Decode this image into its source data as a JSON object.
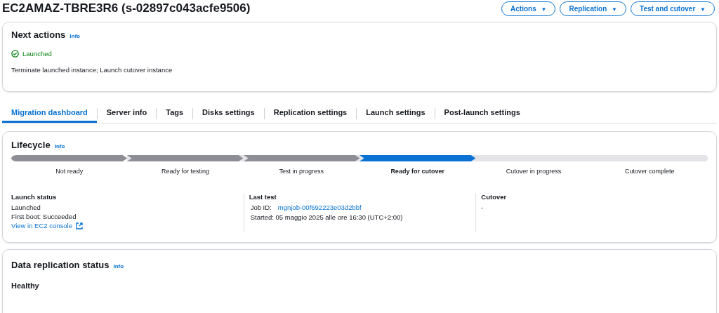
{
  "header": {
    "title": "EC2AMAZ-TBRE3R6 (s-02897c043acfe9506)",
    "buttons": [
      {
        "label": "Actions",
        "caret": "▼"
      },
      {
        "label": "Replication",
        "caret": "▼"
      },
      {
        "label": "Test and cutover",
        "caret": "▼"
      }
    ]
  },
  "next_actions": {
    "title": "Next actions",
    "info": "Info",
    "status": "Launched",
    "description": "Terminate launched instance; Launch cutover instance"
  },
  "tabs": [
    {
      "label": "Migration dashboard",
      "selected": true
    },
    {
      "label": "Server info",
      "selected": false
    },
    {
      "label": "Tags",
      "selected": false
    },
    {
      "label": "Disks settings",
      "selected": false
    },
    {
      "label": "Replication settings",
      "selected": false
    },
    {
      "label": "Launch settings",
      "selected": false
    },
    {
      "label": "Post-launch settings",
      "selected": false
    }
  ],
  "lifecycle": {
    "title": "Lifecycle",
    "info": "Info",
    "steps": [
      {
        "label": "Not ready",
        "done": true,
        "selected": false
      },
      {
        "label": "Ready for testing",
        "done": true,
        "selected": false
      },
      {
        "label": "Test in progress",
        "done": true,
        "selected": false
      },
      {
        "label": "Ready for cutover",
        "done": false,
        "selected": true
      },
      {
        "label": "Cutover in progress",
        "done": false,
        "selected": false
      },
      {
        "label": "Cutover complete",
        "done": false,
        "selected": false
      }
    ],
    "columns": [
      {
        "heading": "Launch status",
        "lines": [
          "Launched",
          "First boot: Succeeded"
        ],
        "link": "View in EC2 console"
      },
      {
        "heading": "Last test",
        "job_label": "Job ID:",
        "job_link": "mgnjob-00f692223e03d2bbf",
        "lines": [
          "Started: 05 maggio 2025 alle ore 16:30 (UTC+2:00)"
        ]
      },
      {
        "heading": "Cutover",
        "lines": [
          "-"
        ]
      }
    ]
  },
  "data_replication": {
    "title": "Data replication status",
    "info": "Info",
    "status": "Healthy"
  }
}
